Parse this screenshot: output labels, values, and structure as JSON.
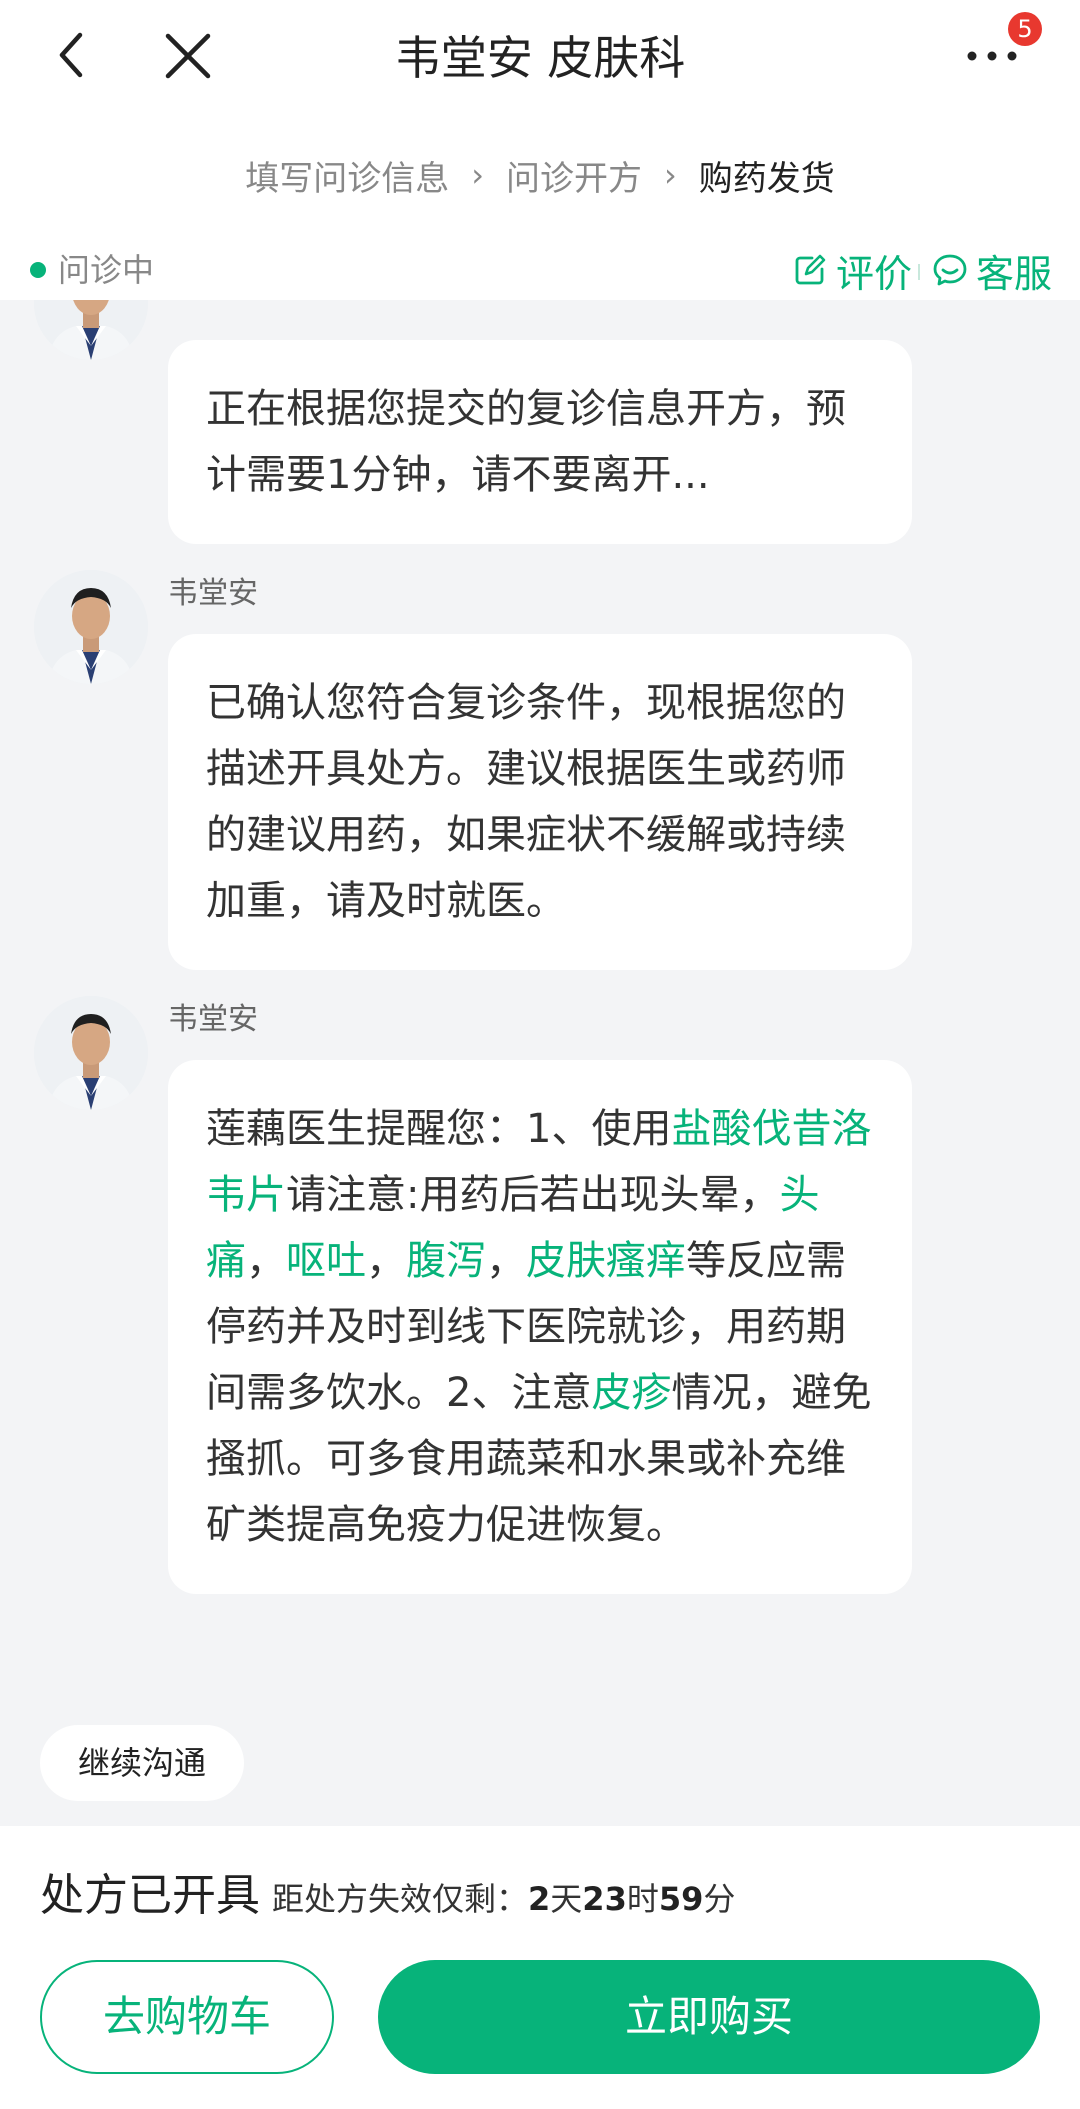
{
  "header": {
    "title": "韦堂安 皮肤科",
    "badge_count": "5",
    "back_icon": "chevron-left-icon",
    "close_icon": "close-icon",
    "more_icon": "more-dots-icon"
  },
  "steps": [
    "填写问诊信息",
    "问诊开方",
    "购药发货"
  ],
  "status": {
    "text": "问诊中",
    "evaluate_label": "评价",
    "service_label": "客服"
  },
  "messages": [
    {
      "sender": "",
      "segments": [
        {
          "text": "正在根据您提交的复诊信息开方，预计需要1分钟，请不要离开..."
        }
      ]
    },
    {
      "sender": "韦堂安",
      "segments": [
        {
          "text": "已确认您符合复诊条件，现根据您的描述开具处方。建议根据医生或药师的建议用药，如果症状不缓解或持续加重，请及时就医。"
        }
      ]
    },
    {
      "sender": "韦堂安",
      "segments": [
        {
          "text": "莲藕医生提醒您：1、使用"
        },
        {
          "text": "盐酸伐昔洛韦片",
          "highlight": true
        },
        {
          "text": "请注意:用药后若出现头晕，"
        },
        {
          "text": "头痛",
          "highlight": true
        },
        {
          "text": "，"
        },
        {
          "text": "呕吐",
          "highlight": true
        },
        {
          "text": "，"
        },
        {
          "text": "腹泻",
          "highlight": true
        },
        {
          "text": "，"
        },
        {
          "text": "皮肤瘙痒",
          "highlight": true
        },
        {
          "text": "等反应需停药并及时到线下医院就诊，用药期间需多饮水。2、注意"
        },
        {
          "text": "皮疹",
          "highlight": true
        },
        {
          "text": "情况，避免搔抓。可多食用蔬菜和水果或补充维矿类提高免疫力促进恢复。"
        }
      ]
    }
  ],
  "continue_label": "继续沟通",
  "prescription": {
    "title": "处方已开具",
    "countdown_prefix": "距处方失效仅剩：",
    "days": "2",
    "days_unit": "天",
    "hours": "23",
    "hours_unit": "时",
    "minutes": "59",
    "minutes_unit": "分"
  },
  "actions": {
    "cart_label": "去购物车",
    "buy_label": "立即购买"
  },
  "colors": {
    "accent": "#07b37a",
    "badge": "#e8382f",
    "background": "#f3f4f6"
  }
}
